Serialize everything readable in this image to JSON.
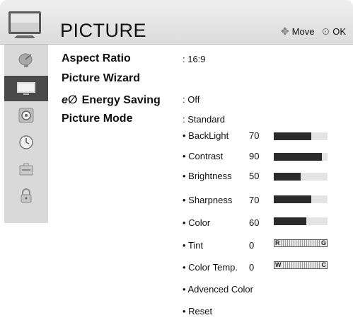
{
  "header": {
    "title": "PICTURE",
    "move_hint": "Move",
    "ok_hint": "OK",
    "icon": "tv-icon"
  },
  "sidebar": {
    "items": [
      {
        "icon": "satellite-dish-icon",
        "active": false
      },
      {
        "icon": "tv-picture-icon",
        "active": true
      },
      {
        "icon": "speaker-icon",
        "active": false
      },
      {
        "icon": "clock-icon",
        "active": false
      },
      {
        "icon": "briefcase-lock-icon",
        "active": false
      },
      {
        "icon": "padlock-icon",
        "active": false
      }
    ]
  },
  "menu": {
    "aspect_ratio": {
      "label": "Aspect Ratio",
      "value": ": 16:9"
    },
    "picture_wizard": {
      "label": "Picture Wizard"
    },
    "energy_saving": {
      "logo": "e∅",
      "label": "Energy Saving",
      "value": ": Off"
    },
    "picture_mode": {
      "label": "Picture Mode",
      "value": ": Standard"
    }
  },
  "settings": [
    {
      "label": "• BackLight",
      "value": "70",
      "level": 70
    },
    {
      "label": "• Contrast",
      "value": "90",
      "level": 90
    },
    {
      "label": "• Brightness",
      "value": "50",
      "level": 50
    },
    {
      "label": "• Sharpness",
      "value": "70",
      "level": 70
    },
    {
      "label": "• Color",
      "value": "60",
      "level": 60
    }
  ],
  "balance": [
    {
      "label": "• Tint",
      "value": "0",
      "left": "R",
      "right": "G"
    },
    {
      "label": "• Color Temp.",
      "value": "0",
      "left": "W",
      "right": "C"
    }
  ],
  "extra": [
    {
      "label": "• Advenced Color"
    },
    {
      "label": "• Reset"
    }
  ],
  "colors": {
    "header_bg": "#e4e4e4",
    "sidebar_bg": "#d9d9d9",
    "active_bg": "#4a4a4a",
    "bar_fill": "#2b2b2b",
    "bar_track": "#e4e4e4"
  }
}
